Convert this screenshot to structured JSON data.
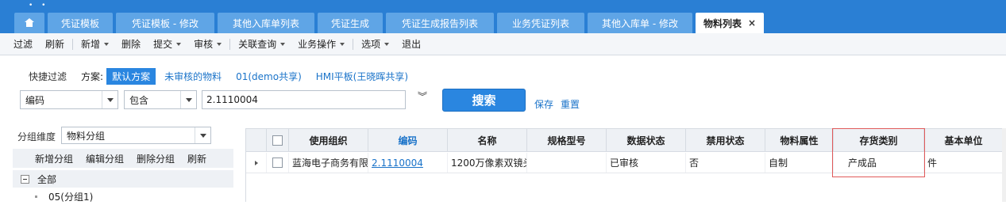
{
  "tabs": [
    {
      "label": "凭证模板"
    },
    {
      "label": "凭证模板 - 修改"
    },
    {
      "label": "其他入库单列表"
    },
    {
      "label": "凭证生成"
    },
    {
      "label": "凭证生成报告列表"
    },
    {
      "label": "业务凭证列表"
    },
    {
      "label": "其他入库单 - 修改"
    },
    {
      "label": "物料列表",
      "close": "×"
    }
  ],
  "toolbar": {
    "filter": "过滤",
    "refresh": "刷新",
    "new": "新增",
    "delete": "删除",
    "submit": "提交",
    "audit": "审核",
    "related": "关联查询",
    "business": "业务操作",
    "options": "选项",
    "exit": "退出"
  },
  "filter": {
    "quick_label": "快捷过滤",
    "scheme_label": "方案:",
    "schemes": [
      "默认方案",
      "未审核的物料",
      "01(demo共享)",
      "HMI平板(王晓晖共享)"
    ],
    "field": "编码",
    "operator": "包含",
    "value": "2.1110004",
    "collapse_glyph": "︾",
    "search": "搜索",
    "save": "保存",
    "reset": "重置"
  },
  "left_panel": {
    "dimension_label": "分组维度",
    "dimension_value": "物料分组",
    "toolbar": [
      "新增分组",
      "编辑分组",
      "删除分组",
      "刷新"
    ],
    "tree": [
      {
        "label": "全部"
      },
      {
        "label": "05(分组1)"
      }
    ]
  },
  "grid": {
    "columns": [
      "使用组织",
      "编码",
      "名称",
      "规格型号",
      "数据状态",
      "禁用状态",
      "物料属性",
      "存货类别",
      "基本单位"
    ],
    "rows": [
      {
        "org": "蓝海电子商务有限",
        "code": "2.1110004",
        "name": "1200万像素双镜头",
        "spec": "",
        "data_status": "已审核",
        "disabled": "否",
        "attr": "自制",
        "category": "产成品",
        "unit": "件"
      }
    ]
  },
  "colors": {
    "brand": "#2a7fd4",
    "accent": "#2a86e0",
    "highlight": "#e05a5a",
    "link": "#1a73c9"
  }
}
